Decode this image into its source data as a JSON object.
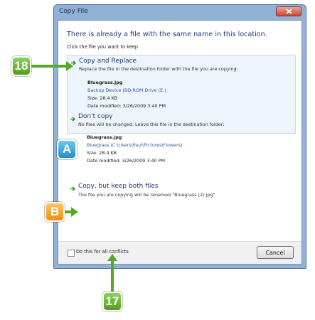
{
  "window": {
    "title": "Copy File"
  },
  "dialog": {
    "heading": "There is already a file with the same name in this location.",
    "subheading": "Click the file you want to keep",
    "options": [
      {
        "title": "Copy and Replace",
        "description": "Replace the file in the destination folder with the file you are copying:",
        "file_name": "Bluegrass.jpg",
        "location": "Backup Device (BD-ROM Drive (E:)",
        "size": "Size: 28.4 KB",
        "modified": "Date modified: 3/26/2009 3:40 PM"
      },
      {
        "title": "Don't copy",
        "description": "No files will be changed. Leave this file in the destination folder:",
        "file_name": "Bluegrass.jpg",
        "location": "Bluegrass (C:\\Users\\Paul\\Pictures\\Flowers)",
        "size": "Size: 28.4 KB",
        "modified": "Date modified: 3/26/2009 3:40 PM"
      },
      {
        "title": "Copy, but keep both files",
        "description": "The file you are copying will be renamed \"Bluegrass (2).jpg\""
      }
    ],
    "checkbox_label": "Do this for all conflicts",
    "cancel_label": "Cancel"
  },
  "callouts": {
    "c18": "18",
    "cA": "A",
    "cB": "B",
    "c17": "17"
  },
  "colors": {
    "callout_green": "#58a828",
    "callout_blue": "#1e8fcf",
    "callout_orange": "#f08f12",
    "link_blue": "#1f3b7a"
  }
}
